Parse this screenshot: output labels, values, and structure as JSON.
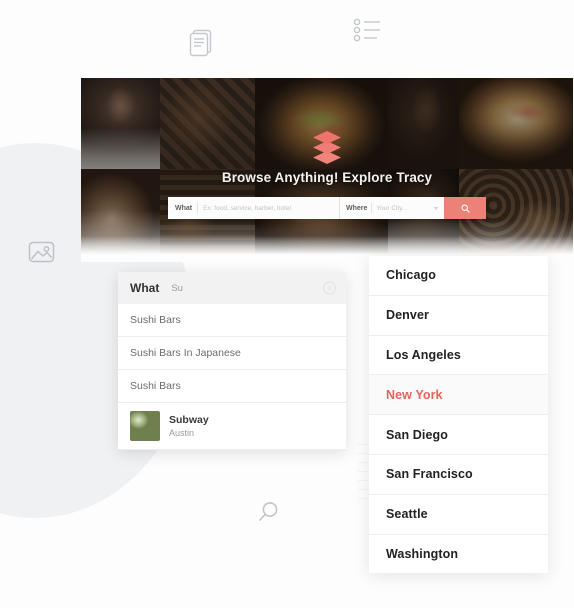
{
  "page": {
    "background_color": "#fdfdfd",
    "accent_color": "#ec8178",
    "active_city_color": "#e8625f"
  },
  "placeholder_icons": [
    {
      "name": "document-icon",
      "label": "document placeholder"
    },
    {
      "name": "list-icon",
      "label": "list placeholder"
    },
    {
      "name": "image-icon",
      "label": "image placeholder"
    },
    {
      "name": "search-icon",
      "label": "search placeholder"
    }
  ],
  "hero": {
    "title": "Browse Anything! Explore Tracy",
    "logo_name": "layers-logo",
    "search": {
      "what_label": "What",
      "what_placeholder": "Ex: food, service, barber, hotel",
      "what_value": "",
      "where_label": "Where",
      "where_placeholder": "Your City...",
      "where_value": "",
      "submit_icon": "search-icon"
    }
  },
  "suggestions": {
    "header_label": "What",
    "query": "Su",
    "clear_icon": "clear-circle-icon",
    "terms": [
      "Sushi Bars",
      "Sushi Bars In Japanese",
      "Sushi Bars"
    ],
    "business": {
      "name": "Subway",
      "location": "Austin",
      "thumb_name": "business-thumbnail"
    }
  },
  "cities": {
    "items": [
      {
        "label": "Chicago",
        "active": false
      },
      {
        "label": "Denver",
        "active": false
      },
      {
        "label": "Los Angeles",
        "active": false
      },
      {
        "label": "New York",
        "active": true
      },
      {
        "label": "San Diego",
        "active": false
      },
      {
        "label": "San Francisco",
        "active": false
      },
      {
        "label": "Seattle",
        "active": false
      },
      {
        "label": "Washington",
        "active": false
      }
    ]
  }
}
